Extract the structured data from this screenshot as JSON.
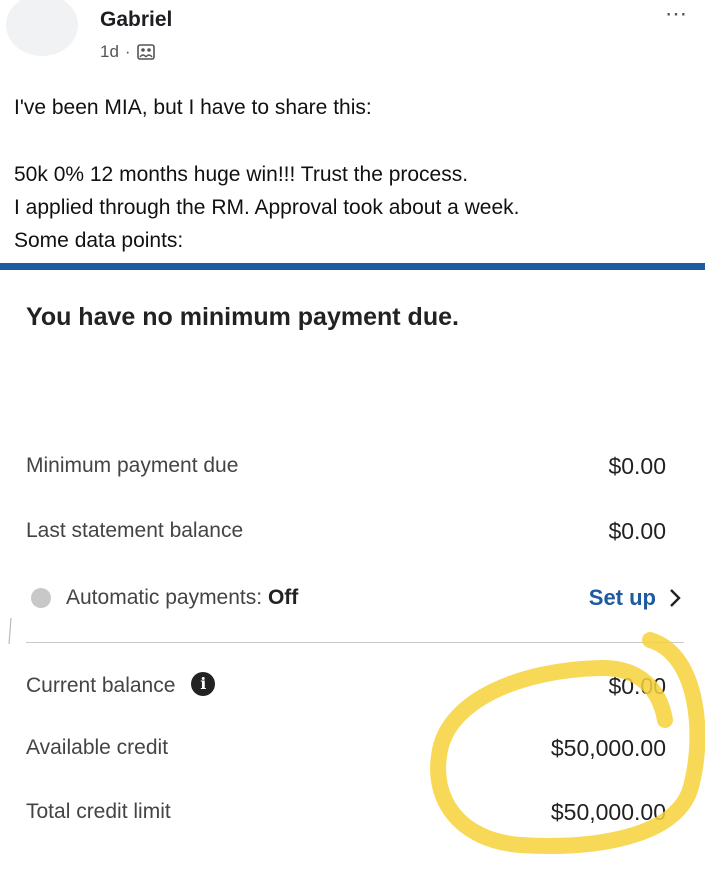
{
  "post": {
    "author": "Gabriel",
    "time": "1d",
    "separator": "·",
    "lines_intro": "I've been MIA, but I have to share this:",
    "line1": "50k 0% 12 months huge win!!! Trust the process.",
    "line2": "I applied through the RM. Approval took about a week.",
    "line3": "Some data points:",
    "more_icon": "⋯"
  },
  "account": {
    "title": "You have no minimum payment due.",
    "minimum_payment_label": "Minimum payment due",
    "minimum_payment_value": "$0.00",
    "last_statement_label": "Last statement balance",
    "last_statement_value": "$0.00",
    "autopay_label": "Automatic payments:",
    "autopay_status": "Off",
    "setup_label": "Set up",
    "current_balance_label": "Current balance",
    "current_balance_value": "$0.00",
    "available_credit_label": "Available credit",
    "available_credit_value": "$50,000.00",
    "total_limit_label": "Total credit limit",
    "total_limit_value": "$50,000.00",
    "info_glyph": "i"
  },
  "colors": {
    "accent_blue": "#1d5aa0",
    "highlight_yellow": "#f7d23a"
  }
}
